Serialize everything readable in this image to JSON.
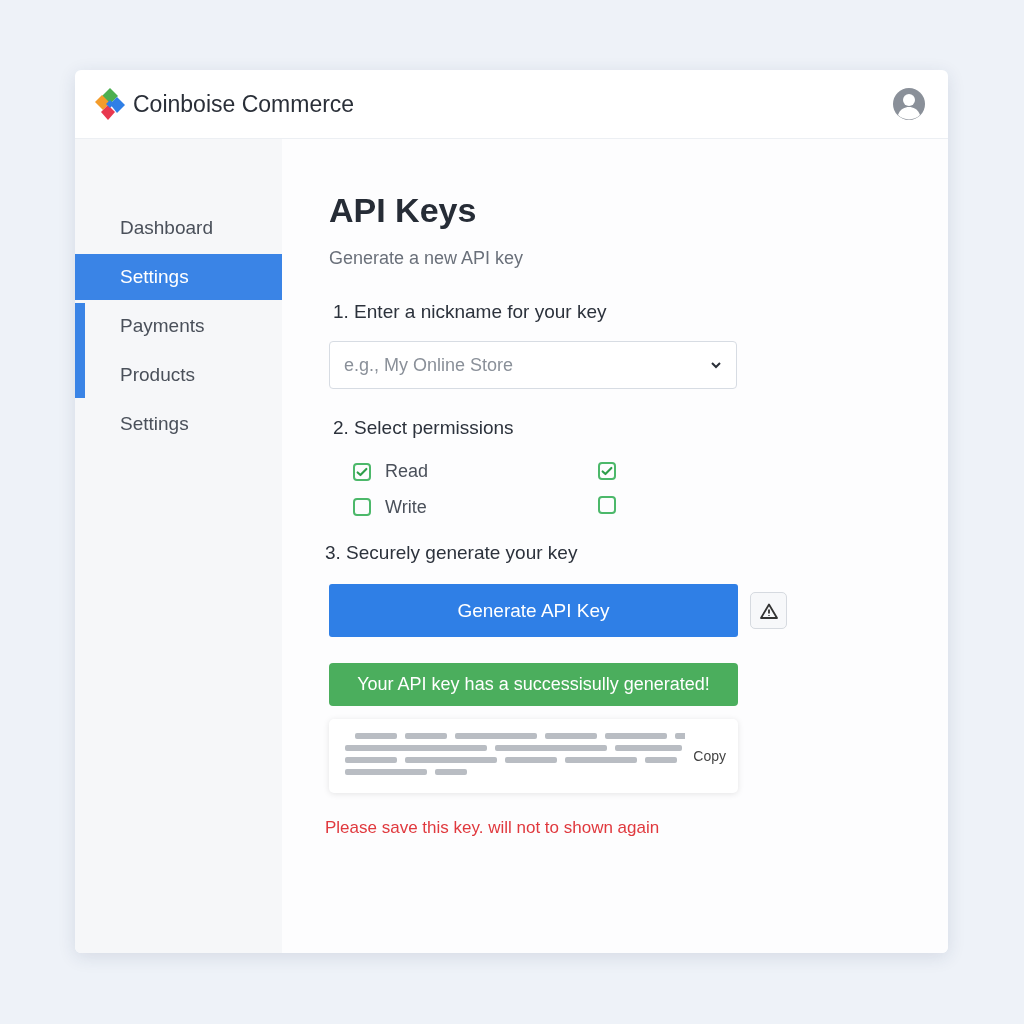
{
  "header": {
    "brand": "Coinboise Commerce"
  },
  "sidebar": {
    "items": [
      {
        "label": "Dashboard",
        "selected": false
      },
      {
        "label": "Settings",
        "selected": true
      },
      {
        "label": "Payments",
        "selected": false
      },
      {
        "label": "Products",
        "selected": false
      },
      {
        "label": "Settings",
        "selected": false
      }
    ]
  },
  "main": {
    "title": "API Keys",
    "subtitle": "Generate a new API key",
    "step_1": "1. Enter a nickname for your key",
    "nickname": {
      "placeholder": "e.g., My Online Store"
    },
    "step_2": "2. Select permissions",
    "permissions": [
      {
        "label": "Read",
        "checked": true,
        "column_2_checked": true
      },
      {
        "label": "Write",
        "checked": false,
        "column_2_checked": false
      }
    ],
    "step_3": "3. Securely generate your key",
    "generate_button": "Generate API Key",
    "success_banner": "Your API key has a successisully generated!",
    "copy_button": "Copy",
    "warning": "Please save this key. will not to shown again"
  }
}
